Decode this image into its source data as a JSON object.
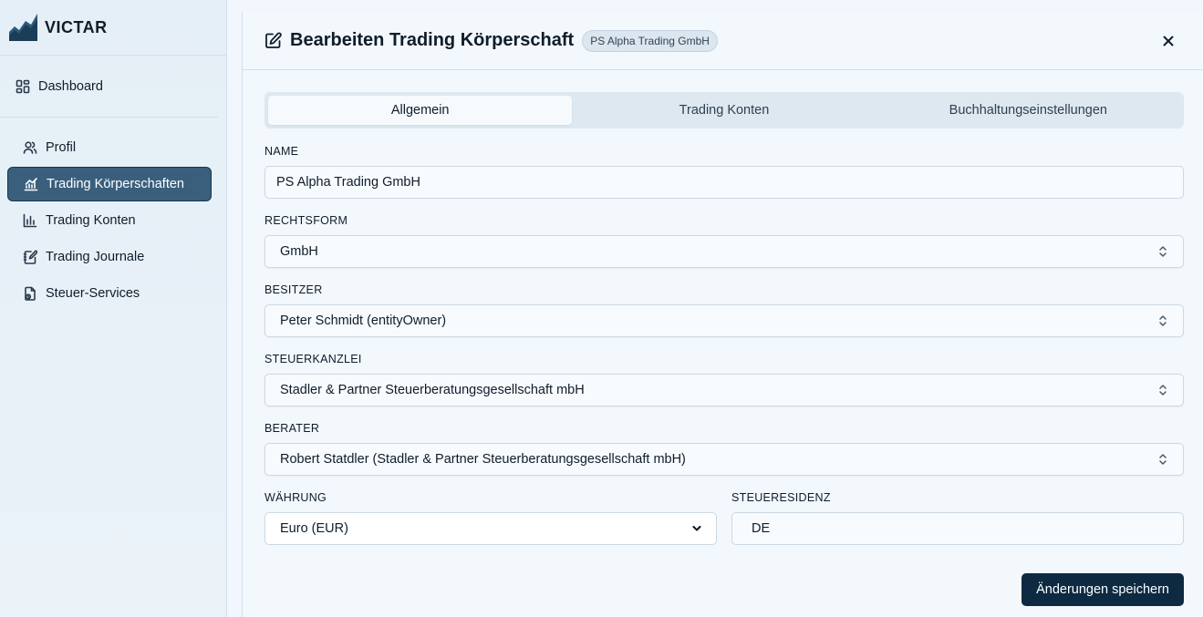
{
  "brand": {
    "name": "VICTAR"
  },
  "sidebar": {
    "dashboard_label": "Dashboard",
    "items": [
      {
        "label": "Profil",
        "icon": "users-icon"
      },
      {
        "label": "Trading Körperschaften",
        "icon": "chart-icon",
        "active": true
      },
      {
        "label": "Trading Konten",
        "icon": "chart-column-icon"
      },
      {
        "label": "Trading Journale",
        "icon": "notebook-pen-icon"
      },
      {
        "label": "Steuer-Services",
        "icon": "file-tax-icon"
      }
    ]
  },
  "dialog": {
    "title": "Bearbeiten Trading Körperschaft",
    "badge": "PS Alpha Trading GmbH",
    "tabs": [
      {
        "label": "Allgemein",
        "active": true
      },
      {
        "label": "Trading Konten"
      },
      {
        "label": "Buchhaltungseinstellungen"
      }
    ],
    "fields": {
      "name": {
        "label": "NAME",
        "value": "PS Alpha Trading GmbH"
      },
      "rechtsform": {
        "label": "RECHTSFORM",
        "value": "GmbH"
      },
      "besitzer": {
        "label": "BESITZER",
        "value": "Peter Schmidt (entityOwner)"
      },
      "steuerkanzlei": {
        "label": "STEUERKANZLEI",
        "value": "Stadler & Partner Steuerberatungsgesellschaft mbH"
      },
      "berater": {
        "label": "BERATER",
        "value": "Robert Statdler (Stadler & Partner Steuerberatungsgesellschaft mbH)"
      },
      "waehrung": {
        "label": "WÄHRUNG",
        "value": "Euro (EUR)"
      },
      "steuerresidenz": {
        "label": "STEUERESIDENZ",
        "value": "DE"
      }
    },
    "save_label": "Änderungen speichern"
  },
  "colors": {
    "accent": "#3a5f7d",
    "primary_button": "#0d2a42",
    "background": "#f1f7fc"
  }
}
